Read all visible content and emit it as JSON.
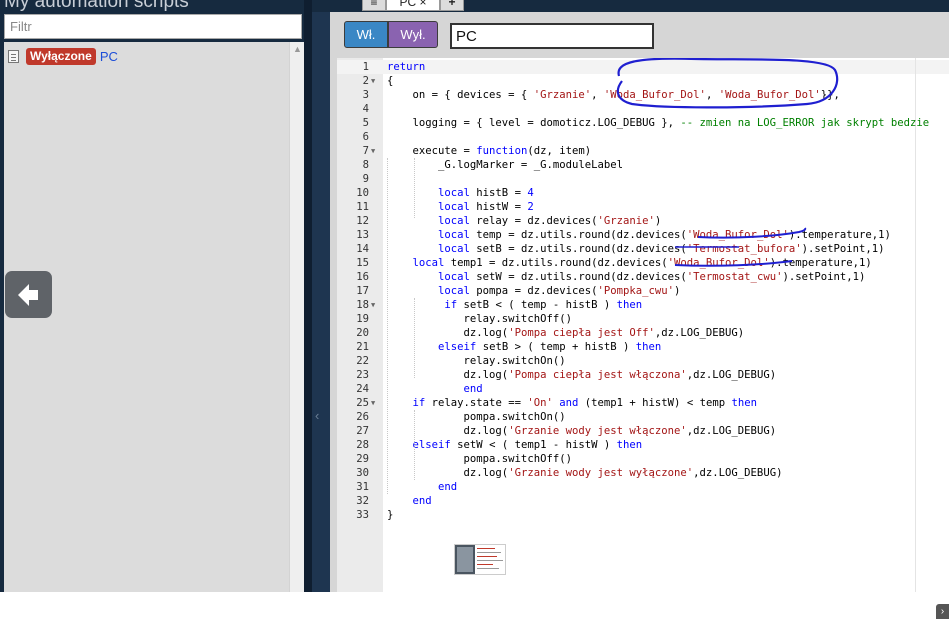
{
  "left_panel": {
    "title": "My automation scripts",
    "filter_placeholder": "Filtr",
    "scripts": [
      {
        "status": "Wyłączone",
        "name": "PC"
      }
    ]
  },
  "tabs": [
    {
      "label": ""
    },
    {
      "label": "PC"
    },
    {
      "label": ""
    }
  ],
  "toolbar": {
    "on_label": "Wł.",
    "off_label": "Wył.",
    "script_name_value": "PC"
  },
  "icons": {
    "back": "arrow-left-icon",
    "collapse": "chevron-left-icon",
    "doc": "document-icon"
  },
  "colors": {
    "status_off": "#c0392b",
    "on_button": "#3a87c5",
    "off_button": "#8a63b0",
    "annotation": "#1f1fd0"
  },
  "editor": {
    "lines": [
      [
        [
          "return",
          "kw"
        ]
      ],
      [
        [
          "{",
          ""
        ]
      ],
      [
        [
          "    on = { devices = { ",
          ""
        ],
        [
          "'Grzanie'",
          "str"
        ],
        [
          ", ",
          ""
        ],
        [
          "'Woda_Bufor_Dol'",
          "str"
        ],
        [
          ", ",
          ""
        ],
        [
          "'Woda_Bufor_Dol'",
          "str"
        ],
        [
          "}},",
          ""
        ]
      ],
      [
        [
          "",
          ""
        ]
      ],
      [
        [
          "    logging = { level = domoticz.LOG_DEBUG }, ",
          ""
        ],
        [
          "-- zmien na LOG_ERROR jak skrypt bedzie",
          "cm"
        ]
      ],
      [
        [
          "",
          ""
        ]
      ],
      [
        [
          "    execute = ",
          ""
        ],
        [
          "function",
          "kw"
        ],
        [
          "(dz, item)",
          ""
        ]
      ],
      [
        [
          "        _G.logMarker = _G.moduleLabel",
          ""
        ]
      ],
      [
        [
          "",
          ""
        ]
      ],
      [
        [
          "        ",
          ""
        ],
        [
          "local",
          "kw"
        ],
        [
          " histB = ",
          ""
        ],
        [
          "4",
          "kw"
        ]
      ],
      [
        [
          "        ",
          ""
        ],
        [
          "local",
          "kw"
        ],
        [
          " histW = ",
          ""
        ],
        [
          "2",
          "kw"
        ]
      ],
      [
        [
          "        ",
          ""
        ],
        [
          "local",
          "kw"
        ],
        [
          " relay = dz.devices(",
          ""
        ],
        [
          "'Grzanie'",
          "str"
        ],
        [
          ")",
          ""
        ]
      ],
      [
        [
          "        ",
          ""
        ],
        [
          "local",
          "kw"
        ],
        [
          " temp = dz.utils.round(dz.devices(",
          ""
        ],
        [
          "'Woda_Bufor_Dol'",
          "str"
        ],
        [
          ").temperature,1)",
          ""
        ]
      ],
      [
        [
          "        ",
          ""
        ],
        [
          "local",
          "kw"
        ],
        [
          " setB = dz.utils.round(dz.devices(",
          ""
        ],
        [
          "'Termostat_bufora'",
          "str"
        ],
        [
          ").setPoint,1)",
          ""
        ]
      ],
      [
        [
          "    ",
          ""
        ],
        [
          "local",
          "kw"
        ],
        [
          " temp1 = dz.utils.round(dz.devices(",
          ""
        ],
        [
          "'Woda_Bufor_Dol'",
          "str"
        ],
        [
          ").temperature,1)",
          ""
        ]
      ],
      [
        [
          "        ",
          ""
        ],
        [
          "local",
          "kw"
        ],
        [
          " setW = dz.utils.round(dz.devices(",
          ""
        ],
        [
          "'Termostat_cwu'",
          "str"
        ],
        [
          ").setPoint,1)",
          ""
        ]
      ],
      [
        [
          "        ",
          ""
        ],
        [
          "local",
          "kw"
        ],
        [
          " pompa = dz.devices(",
          ""
        ],
        [
          "'Pompka_cwu'",
          "str"
        ],
        [
          ")",
          ""
        ]
      ],
      [
        [
          "         ",
          ""
        ],
        [
          "if",
          "kw"
        ],
        [
          " setB < ( temp - histB ) ",
          ""
        ],
        [
          "then",
          "kw"
        ]
      ],
      [
        [
          "            relay.switchOff()",
          ""
        ]
      ],
      [
        [
          "            dz.log(",
          ""
        ],
        [
          "'Pompa ciepła jest Off'",
          "str"
        ],
        [
          ",dz.LOG_DEBUG)",
          ""
        ]
      ],
      [
        [
          "        ",
          ""
        ],
        [
          "elseif",
          "kw"
        ],
        [
          " setB > ( temp + histB ) ",
          ""
        ],
        [
          "then",
          "kw"
        ]
      ],
      [
        [
          "            relay.switchOn()",
          ""
        ]
      ],
      [
        [
          "            dz.log(",
          ""
        ],
        [
          "'Pompa ciepła jest włączona'",
          "str"
        ],
        [
          ",dz.LOG_DEBUG)",
          ""
        ]
      ],
      [
        [
          "            ",
          ""
        ],
        [
          "end",
          "kw"
        ]
      ],
      [
        [
          "    ",
          ""
        ],
        [
          "if",
          "kw"
        ],
        [
          " relay.state == ",
          ""
        ],
        [
          "'On'",
          "str"
        ],
        [
          " ",
          ""
        ],
        [
          "and",
          "kw"
        ],
        [
          " (temp1 + histW) < temp ",
          ""
        ],
        [
          "then",
          "kw"
        ]
      ],
      [
        [
          "            pompa.switchOn()",
          ""
        ]
      ],
      [
        [
          "            dz.log(",
          ""
        ],
        [
          "'Grzanie wody jest włączone'",
          "str"
        ],
        [
          ",dz.LOG_DEBUG)",
          ""
        ]
      ],
      [
        [
          "    ",
          ""
        ],
        [
          "elseif",
          "kw"
        ],
        [
          " setW < ( temp1 - histW ) ",
          ""
        ],
        [
          "then",
          "kw"
        ]
      ],
      [
        [
          "            pompa.switchOff()",
          ""
        ]
      ],
      [
        [
          "            dz.log(",
          ""
        ],
        [
          "'Grzanie wody jest wyłączone'",
          "str"
        ],
        [
          ",dz.LOG_DEBUG)",
          ""
        ]
      ],
      [
        [
          "        ",
          ""
        ],
        [
          "end",
          "kw"
        ]
      ],
      [
        [
          "    ",
          ""
        ],
        [
          "end",
          "kw"
        ]
      ],
      [
        [
          "}",
          ""
        ]
      ]
    ],
    "fold_lines": [
      2,
      7,
      18,
      25
    ]
  }
}
